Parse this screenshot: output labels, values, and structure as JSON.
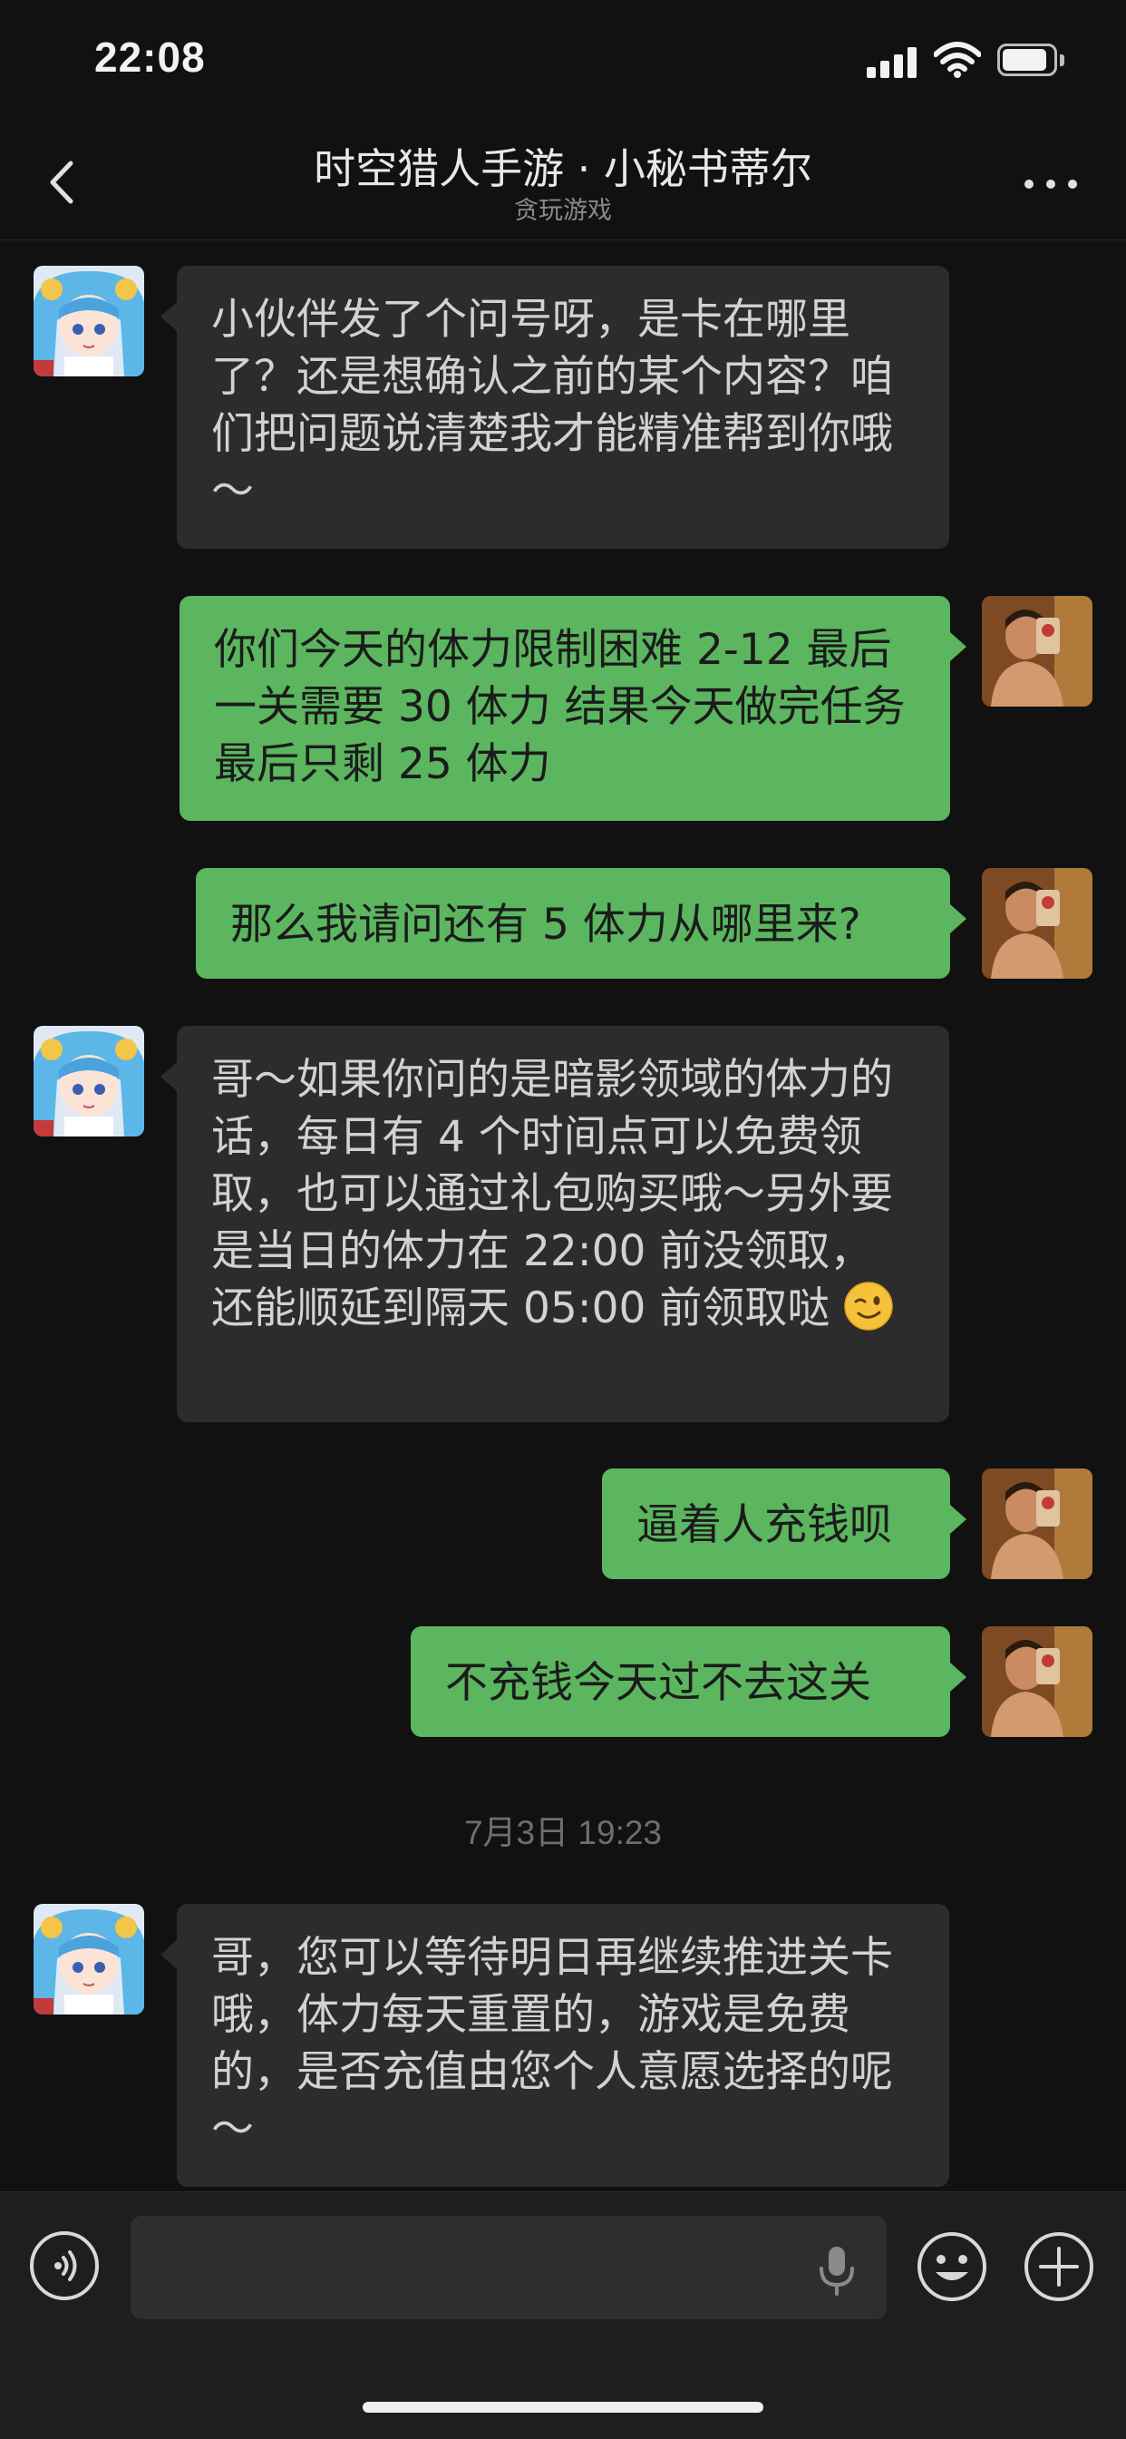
{
  "status_bar": {
    "time": "22:08"
  },
  "nav": {
    "title": "时空猎人手游 · 小秘书蒂尔",
    "subtitle": "贪玩游戏"
  },
  "messages": [
    {
      "from": "bot",
      "text": "小伙伴发了个问号呀，是卡在哪里了？还是想确认之前的某个内容？咱们把问题说清楚我才能精准帮到你哦～"
    },
    {
      "from": "user",
      "text": "你们今天的体力限制困难 2-12 最后一关需要 30 体力  结果今天做完任务最后只剩 25 体力"
    },
    {
      "from": "user",
      "text": "那么我请问还有 5 体力从哪里来?"
    },
    {
      "from": "bot",
      "text": "哥～如果你问的是暗影领域的体力的话，每日有 4 个时间点可以免费领取，也可以通过礼包购买哦～另外要是当日的体力在 22:00 前没领取，还能顺延到隔天 05:00 前领取哒",
      "emoji": "winking-face"
    },
    {
      "from": "user",
      "text": "逼着人充钱呗"
    },
    {
      "from": "user",
      "text": "不充钱今天过不去这关"
    },
    {
      "from": "bot",
      "text": "哥，您可以等待明日再继续推进关卡哦，体力每天重置的，游戏是免费的，是否充值由您个人意愿选择的呢～"
    }
  ],
  "timestamp": "7月3日 19:23",
  "colors": {
    "background": "#111111",
    "incoming_bubble": "#2c2c2c",
    "outgoing_bubble": "#5bb65f",
    "input_bar": "#1e1e1e"
  },
  "icons": {
    "back": "chevron-left-icon",
    "more": "more-dots-icon",
    "voice": "voice-input-icon",
    "mic": "microphone-icon",
    "emoji": "emoji-icon",
    "add": "add-icon"
  }
}
